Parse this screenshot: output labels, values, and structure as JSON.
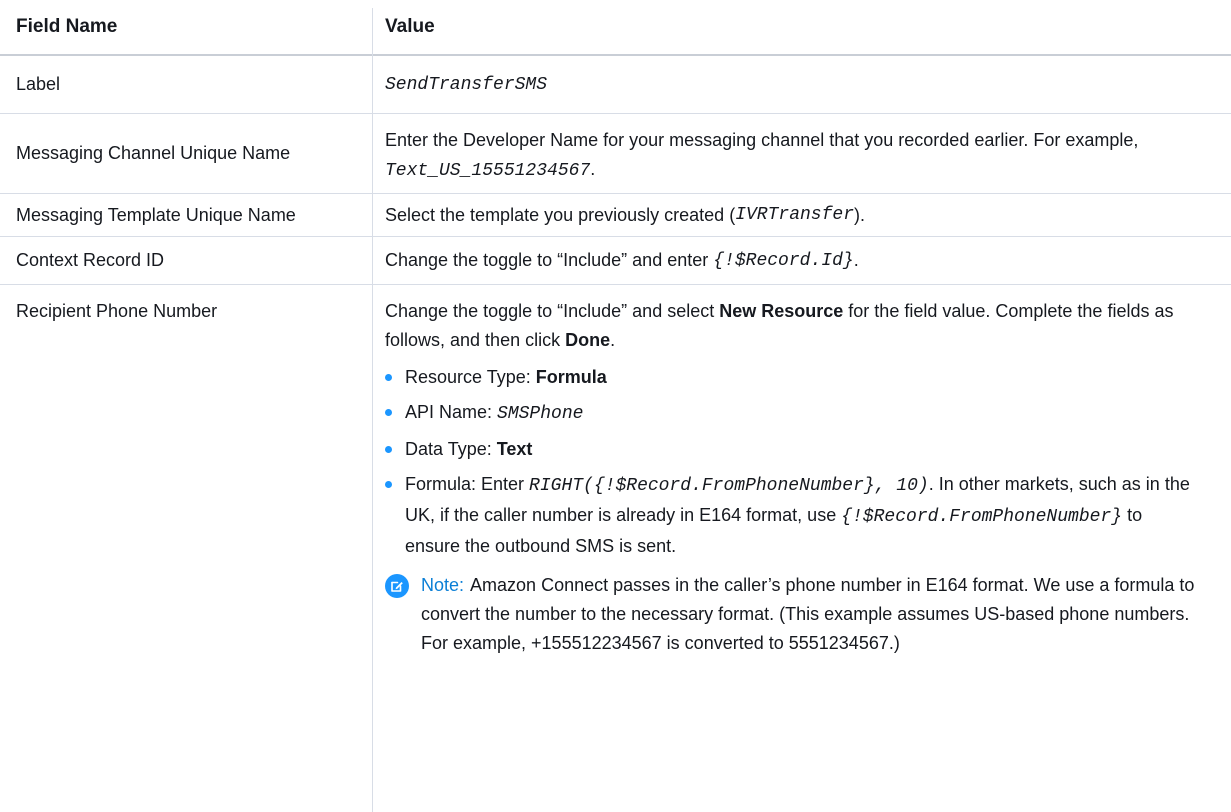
{
  "table": {
    "header": {
      "field_name": "Field Name",
      "value": "Value"
    },
    "rows": {
      "label": {
        "name": "Label",
        "value_code": "SendTransferSMS"
      },
      "channel": {
        "name": "Messaging Channel Unique Name",
        "text1": "Enter the Developer Name for your messaging channel that you recorded earlier. For example, ",
        "code": "Text_US_15551234567",
        "text2": "."
      },
      "template": {
        "name": "Messaging Template Unique Name",
        "text1": "Select the template you previously created (",
        "code": "IVRTransfer",
        "text2": ")."
      },
      "context": {
        "name": "Context Record ID",
        "text1": "Change the toggle to “Include” and enter ",
        "code": "{!$Record.Id}",
        "text2": "."
      },
      "recipient": {
        "name": "Recipient Phone Number",
        "intro1": "Change the toggle to “Include” and select ",
        "intro_bold1": "New Resource",
        "intro2": " for the field value. Complete the fields as follows, and then click ",
        "intro_bold2": "Done",
        "intro3": ".",
        "bullets": [
          {
            "label": "Resource Type: ",
            "bold": "Formula"
          },
          {
            "label": "API Name: ",
            "code": "SMSPhone"
          },
          {
            "label": "Data Type: ",
            "bold": "Text"
          },
          {
            "label": "Formula: Enter ",
            "code": "RIGHT({!$Record.FromPhoneNumber}, 10)",
            "text2": ". In other markets, such as in the UK, if the caller number is already in E164 format, use ",
            "code2": "{!$Record.FromPhoneNumber}",
            "text3": " to ensure the outbound SMS is sent."
          }
        ],
        "note": {
          "label": "Note:",
          "text": "Amazon Connect passes in the caller’s phone number in E164 format. We use a formula to convert the number to the necessary format. (This example assumes US-based phone numbers. For example, +155512234567 is converted to 5551234567.)"
        }
      }
    }
  },
  "colors": {
    "accent": "#1b96ff",
    "note_label": "#0b7fd6",
    "border": "#d8dde6"
  },
  "icons": {
    "bullet": "bullet-dot",
    "note": "edit-note-icon"
  }
}
